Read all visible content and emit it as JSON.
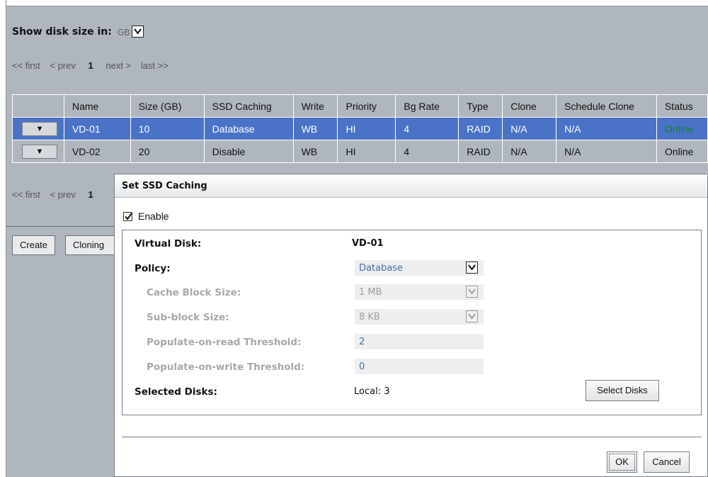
{
  "disk_size": {
    "label": "Show disk size in:",
    "unit": "GB"
  },
  "pager_top": {
    "first": "<< first",
    "prev": "< prev",
    "page": "1",
    "next": "next >",
    "last": "last >>"
  },
  "pager_bottom": {
    "first": "<< first",
    "prev": "< prev",
    "page": "1"
  },
  "table": {
    "columns": [
      "Name",
      "Size (GB)",
      "SSD Caching",
      "Write",
      "Priority",
      "Bg Rate",
      "Type",
      "Clone",
      "Schedule Clone",
      "Status"
    ],
    "rows": [
      {
        "name": "VD-01",
        "size": "10",
        "ssd": "Database",
        "write": "WB",
        "priority": "HI",
        "bg_rate": "4",
        "type": "RAID",
        "clone": "N/A",
        "schedule_clone": "N/A",
        "status": "Online"
      },
      {
        "name": "VD-02",
        "size": "20",
        "ssd": "Disable",
        "write": "WB",
        "priority": "HI",
        "bg_rate": "4",
        "type": "RAID",
        "clone": "N/A",
        "schedule_clone": "N/A",
        "status": "Online"
      }
    ],
    "action_glyph": "▼"
  },
  "bottom_buttons": {
    "create": "Create",
    "cloning": "Cloning"
  },
  "dialog": {
    "title": "Set SSD Caching",
    "enable_label": "Enable",
    "virtual_disk_label": "Virtual Disk:",
    "virtual_disk_value": "VD-01",
    "policy_label": "Policy:",
    "policy_value": "Database",
    "cache_block_label": "Cache Block Size:",
    "cache_block_value": "1 MB",
    "sub_block_label": "Sub-block Size:",
    "sub_block_value": "8 KB",
    "por_label": "Populate-on-read Threshold:",
    "por_value": "2",
    "pow_label": "Populate-on-write Threshold:",
    "pow_value": "0",
    "selected_disks_label": "Selected Disks:",
    "selected_disks_value": "Local: 3",
    "select_disks_button": "Select Disks",
    "ok_button": "OK",
    "cancel_button": "Cancel"
  }
}
